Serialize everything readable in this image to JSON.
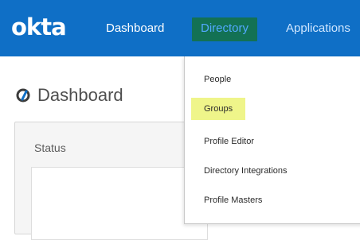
{
  "brand": {
    "logo_text": "okta"
  },
  "nav": {
    "items": [
      {
        "label": "Dashboard"
      },
      {
        "label": "Directory",
        "selected": true
      },
      {
        "label": "Applications"
      }
    ]
  },
  "page": {
    "title": "Dashboard"
  },
  "status": {
    "label": "Status"
  },
  "directory_menu": {
    "items": [
      {
        "label": "People"
      },
      {
        "label": "Groups",
        "highlighted": true
      },
      {
        "label": "Profile Editor"
      },
      {
        "label": "Directory Integrations"
      },
      {
        "label": "Profile Masters"
      }
    ]
  },
  "colors": {
    "topbar": "#0f6fc6",
    "directory_active_bg": "#137154",
    "directory_active_text": "#52a9ff",
    "menu_highlight": "#eff58a"
  }
}
